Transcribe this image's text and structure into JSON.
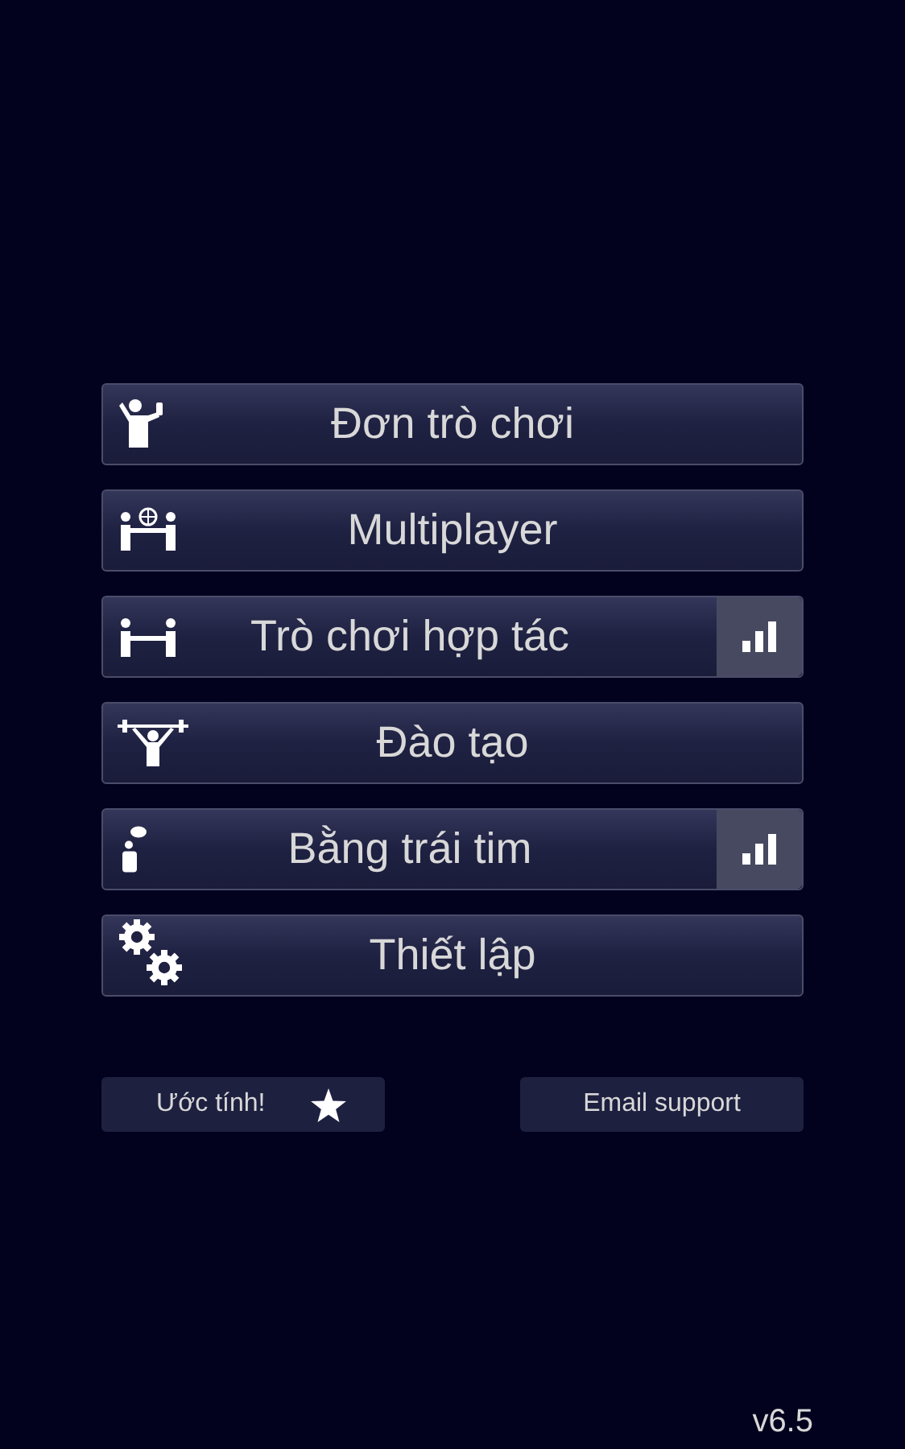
{
  "menu": [
    {
      "label": "Đơn trò chơi",
      "kind": "single",
      "leaderboard": false
    },
    {
      "label": "Multiplayer",
      "kind": "multi",
      "leaderboard": false
    },
    {
      "label": "Trò chơi hợp tác",
      "kind": "coop",
      "leaderboard": true
    },
    {
      "label": "Đào tạo",
      "kind": "training",
      "leaderboard": false
    },
    {
      "label": "Bằng trái tim",
      "kind": "heart",
      "leaderboard": true
    },
    {
      "label": "Thiết lập",
      "kind": "settings",
      "leaderboard": false
    }
  ],
  "rate_button": {
    "label": "Ước tính!"
  },
  "support_button": {
    "label": "Email support"
  },
  "version": "v6.5"
}
